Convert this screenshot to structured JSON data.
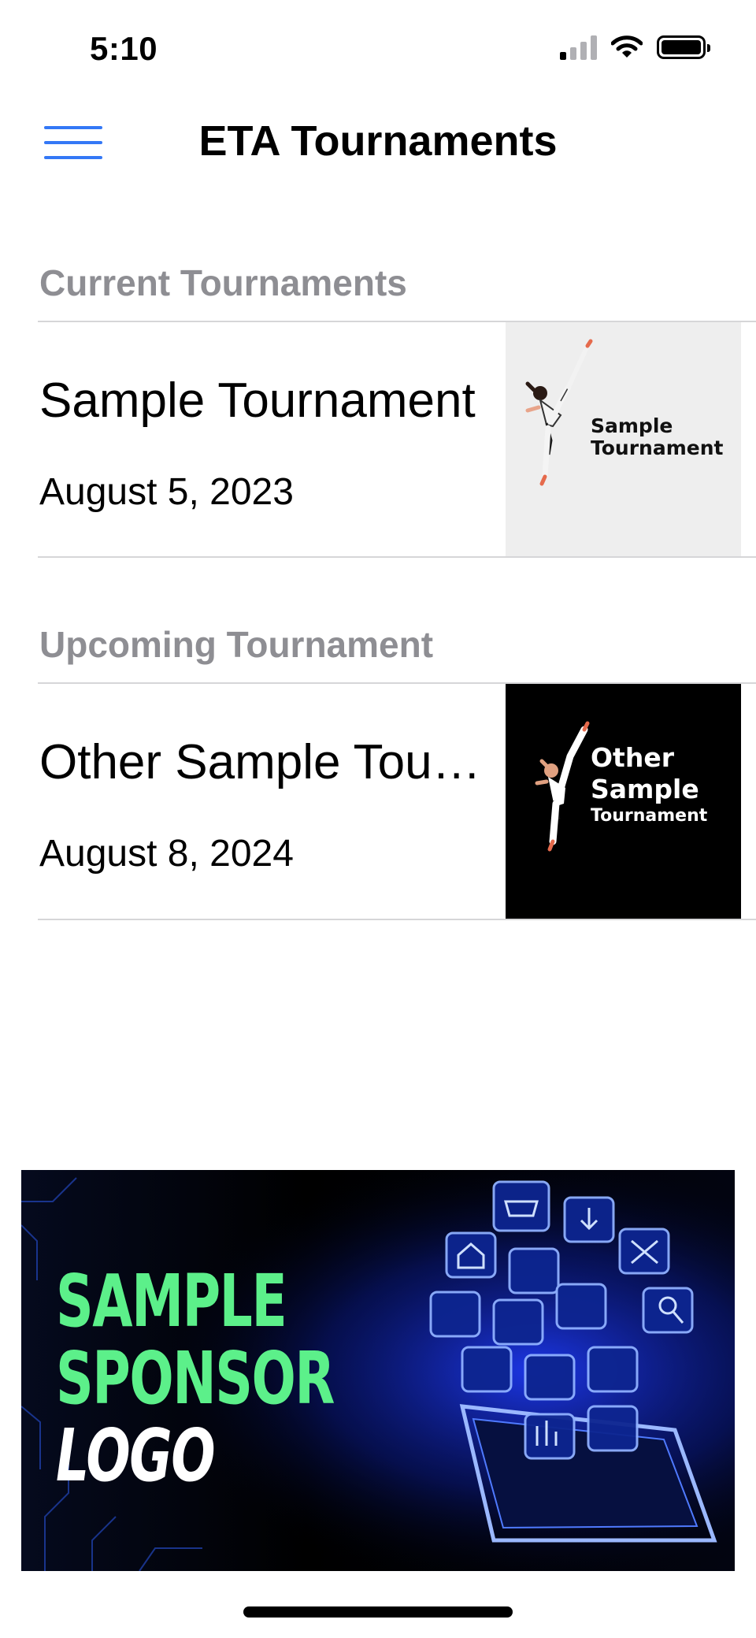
{
  "status_bar": {
    "time": "5:10",
    "icons": [
      "cellular-signal-icon",
      "wifi-icon",
      "battery-icon"
    ]
  },
  "nav": {
    "title": "ETA Tournaments",
    "menu_icon": "hamburger-menu-icon",
    "accent_color": "#3478f6"
  },
  "sections": [
    {
      "header": "Current Tournaments",
      "items": [
        {
          "title": "Sample Tournament",
          "date": "August 5, 2023",
          "thumbnail": {
            "lines": [
              "Sample",
              "Tournament"
            ],
            "background": "#eeeeee",
            "text_color": "#111111"
          }
        }
      ]
    },
    {
      "header": "Upcoming Tournament",
      "items": [
        {
          "title": "Other Sample Tournament",
          "date": "August 8, 2024",
          "thumbnail": {
            "lines": [
              "Other",
              "Sample",
              "Tournament"
            ],
            "background": "#000000",
            "text_color": "#ffffff"
          }
        }
      ]
    }
  ],
  "sponsor": {
    "lines": [
      "SAMPLE",
      "SPONSOR",
      "LOGO"
    ],
    "highlight_color": "#5cf08a",
    "glow_color": "#2f5bff"
  },
  "colors": {
    "section_header": "#8e8e93",
    "divider": "#d6d6d8"
  }
}
